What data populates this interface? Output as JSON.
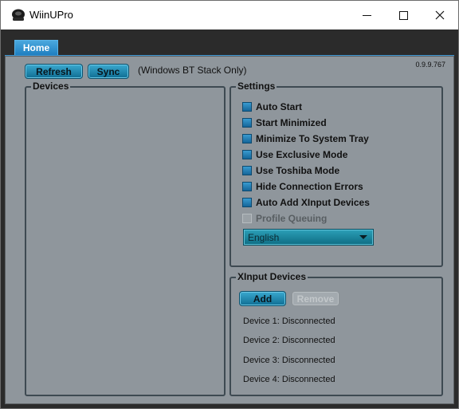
{
  "window": {
    "title": "WiinUPro",
    "controls": [
      "minimize-icon",
      "maximize-icon",
      "close-icon"
    ]
  },
  "tabs": [
    {
      "label": "Home",
      "active": true
    }
  ],
  "version": "0.9.9.767",
  "toolbar": {
    "refresh_label": "Refresh",
    "sync_label": "Sync",
    "stack_note": "(Windows BT Stack Only)"
  },
  "devices": {
    "title": "Devices",
    "items": []
  },
  "settings": {
    "title": "Settings",
    "options": [
      {
        "label": "Auto Start",
        "checked": false,
        "enabled": true
      },
      {
        "label": "Start Minimized",
        "checked": false,
        "enabled": true
      },
      {
        "label": "Minimize To System Tray",
        "checked": false,
        "enabled": true
      },
      {
        "label": "Use Exclusive Mode",
        "checked": false,
        "enabled": true
      },
      {
        "label": "Use Toshiba Mode",
        "checked": false,
        "enabled": true
      },
      {
        "label": "Hide Connection Errors",
        "checked": false,
        "enabled": true
      },
      {
        "label": "Auto Add XInput Devices",
        "checked": false,
        "enabled": true
      },
      {
        "label": "Profile Queuing",
        "checked": false,
        "enabled": false
      }
    ],
    "language": "English"
  },
  "xinput": {
    "title": "XInput Devices",
    "add_label": "Add",
    "remove_label": "Remove",
    "devices": [
      "Device 1: Disconnected",
      "Device 2: Disconnected",
      "Device 3: Disconnected",
      "Device 4: Disconnected"
    ]
  },
  "colors": {
    "accent": "#1f7fc0",
    "panel": "#8f969c",
    "button": "#1a84ab",
    "frame": "#2b2b2b"
  }
}
